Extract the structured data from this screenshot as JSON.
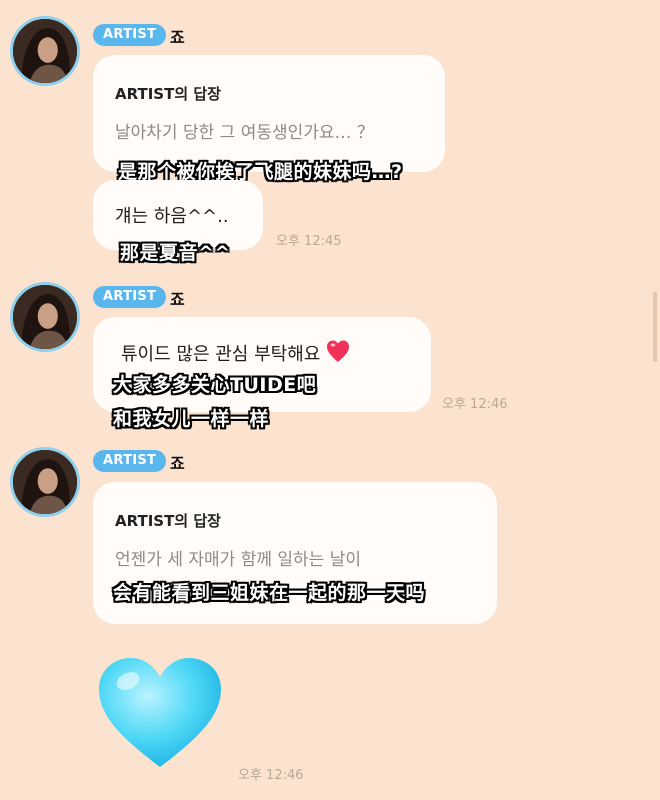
{
  "messages": [
    {
      "badge": "ARTIST",
      "sender": "죠",
      "reply_title": "ARTIST의 답장",
      "reply_quote": "날아차기 당한 그 여동생인가요… ？",
      "caption_1": "是那个被你挨了飞腿的妹妹吗…?",
      "text": "걔는 하음^^..",
      "caption_2": "那是夏音^^",
      "time": "오후 12:45"
    },
    {
      "badge": "ARTIST",
      "sender": "죠",
      "text": "튜이드 많은 관심 부탁해요",
      "emoji": "heart-emoji",
      "caption_1": "大家多多关心TUIDE吧",
      "caption_2": "和我女儿一样一样",
      "time": "오후 12:46"
    },
    {
      "badge": "ARTIST",
      "sender": "죠",
      "reply_title": "ARTIST의 답장",
      "reply_quote": "언젠가 세 자매가 함께 일하는 날이",
      "caption_1": "会有能看到三姐妹在一起的那一天吗",
      "emoji": "light-blue-heart-emoji",
      "time": "오후 12:46"
    }
  ],
  "colors": {
    "background": "#fbe3cf",
    "bubble": "#fffcf9",
    "badge": "#5ab7ee",
    "time": "#b9a797"
  }
}
